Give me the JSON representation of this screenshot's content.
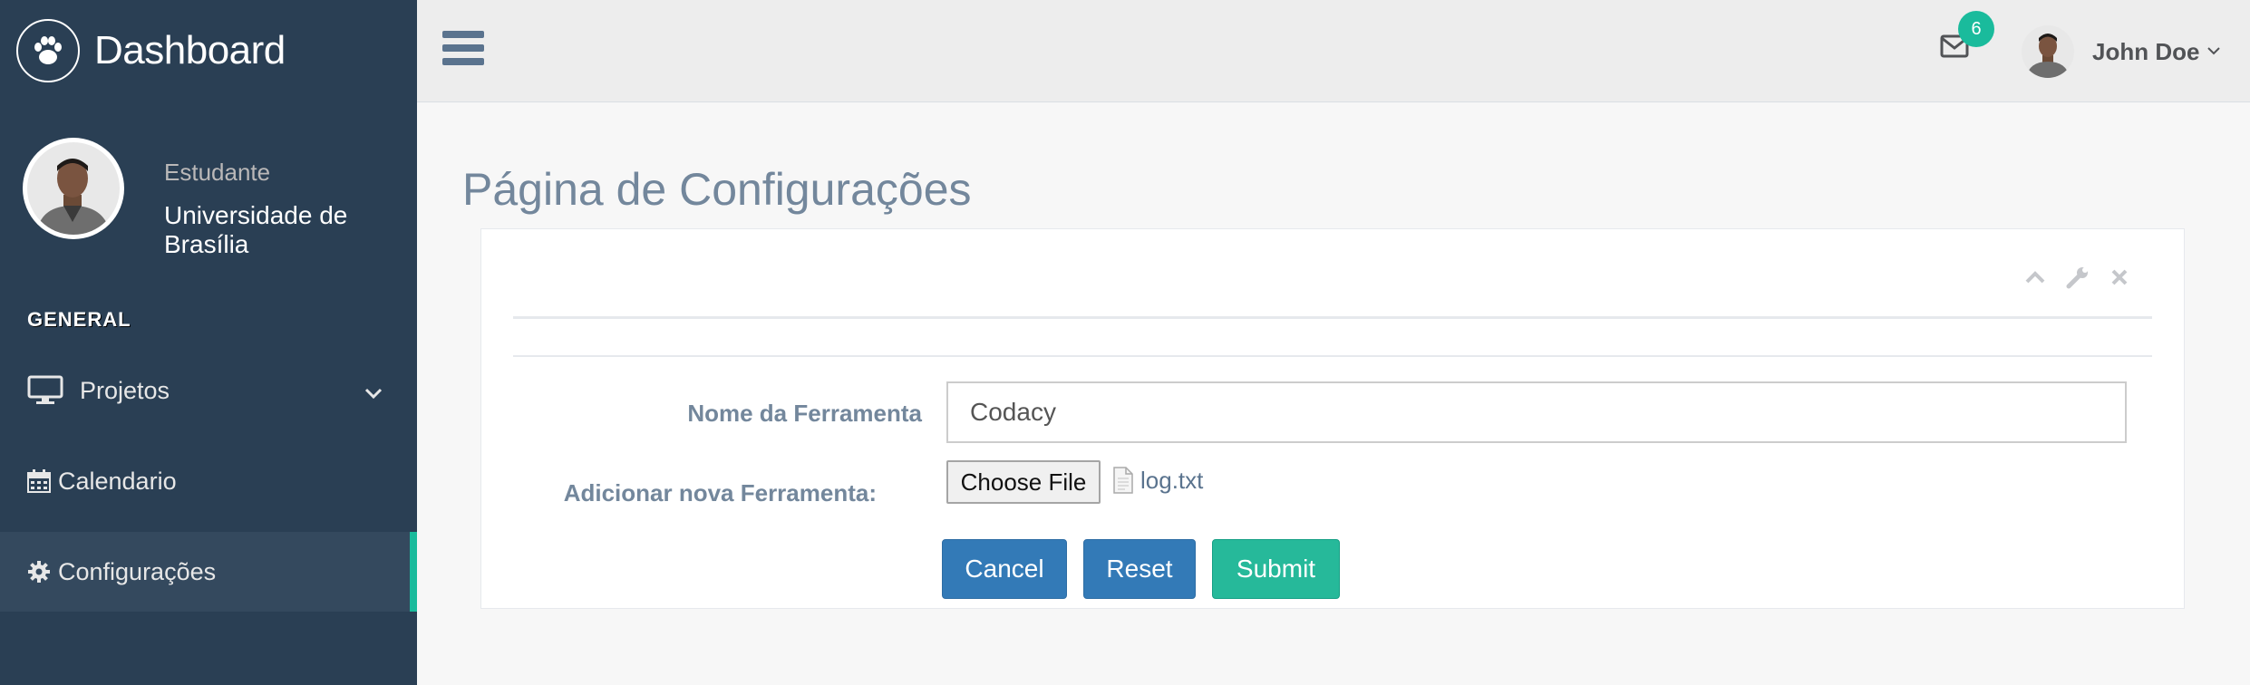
{
  "sidebar": {
    "brand": "Dashboard",
    "profile": {
      "role": "Estudante",
      "university": "Universidade de Brasília"
    },
    "section_title": "GENERAL",
    "items": [
      {
        "label": "Projetos",
        "icon": "monitor-icon"
      },
      {
        "label": "Calendario",
        "icon": "calendar-icon"
      },
      {
        "label": "Configurações",
        "icon": "gear-icon"
      }
    ]
  },
  "topnav": {
    "mail_count": "6",
    "user_name": "John Doe"
  },
  "page": {
    "title": "Página de Configurações"
  },
  "form": {
    "tool_name_label": "Nome da Ferramenta",
    "tool_name_value": "Codacy",
    "add_tool_label": "Adicionar nova Ferramenta:",
    "choose_file_label": "Choose File",
    "file_name": "log.txt",
    "cancel_label": "Cancel",
    "reset_label": "Reset",
    "submit_label": "Submit"
  },
  "colors": {
    "sidebar_bg": "#2A3F54",
    "accent": "#1ABB9C",
    "primary": "#337AB7",
    "success": "#26B99A",
    "title": "#73879C"
  }
}
